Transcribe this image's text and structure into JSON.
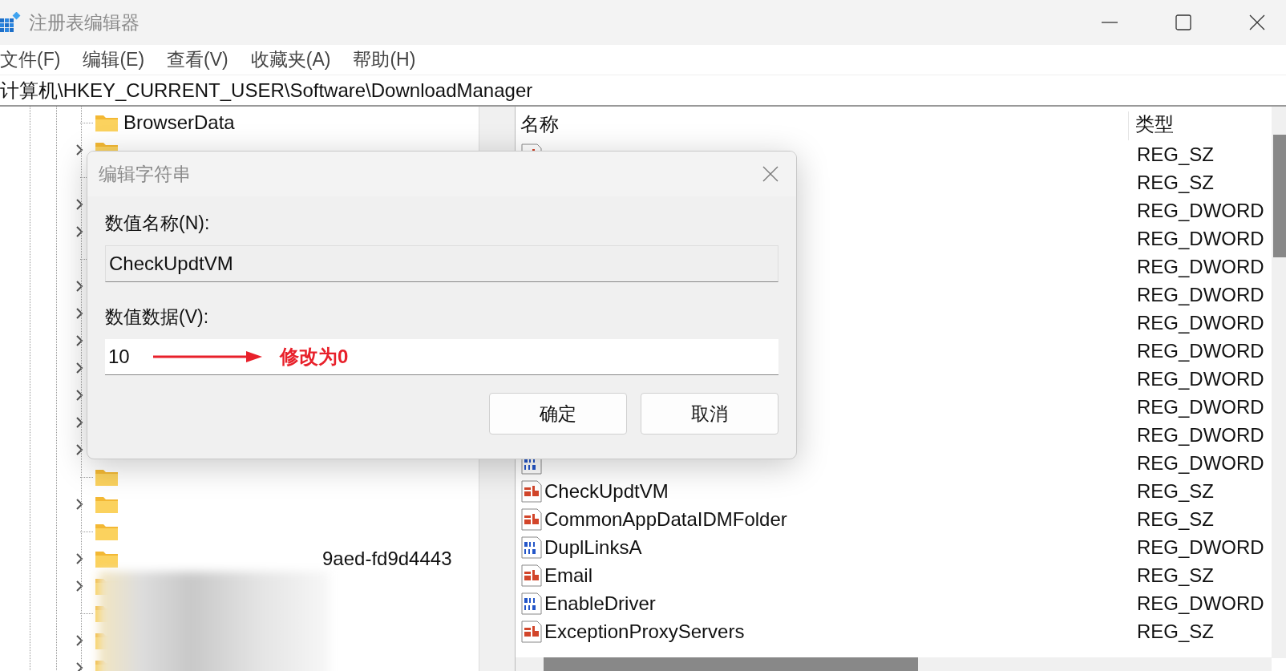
{
  "window": {
    "title": "注册表编辑器"
  },
  "menu": [
    "文件(F)",
    "编辑(E)",
    "查看(V)",
    "收藏夹(A)",
    "帮助(H)"
  ],
  "address": "计算机\\HKEY_CURRENT_USER\\Software\\DownloadManager",
  "tree": [
    {
      "label": "BrowserData",
      "kind": "folder",
      "expandable": false
    },
    {
      "kind": "folder",
      "expandable": true
    },
    {
      "kind": "covered",
      "expandable": false
    },
    {
      "kind": "covered",
      "expandable": true
    },
    {
      "kind": "covered",
      "expandable": true
    },
    {
      "kind": "covered",
      "expandable": false
    },
    {
      "kind": "covered",
      "expandable": true
    },
    {
      "kind": "covered",
      "expandable": true
    },
    {
      "kind": "covered",
      "expandable": true
    },
    {
      "kind": "covered",
      "expandable": true
    },
    {
      "kind": "covered",
      "expandable": true
    },
    {
      "kind": "covered",
      "expandable": true
    },
    {
      "kind": "covered",
      "expandable": true
    },
    {
      "kind": "folder",
      "expandable": false
    },
    {
      "kind": "folder",
      "expandable": true
    },
    {
      "kind": "folder",
      "expandable": false
    },
    {
      "label": "9aed-fd9d4443",
      "kind": "folder",
      "expandable": true,
      "redacted": true
    },
    {
      "kind": "folder",
      "expandable": true
    },
    {
      "kind": "folder",
      "expandable": false
    },
    {
      "kind": "folder",
      "expandable": true
    },
    {
      "kind": "folder",
      "expandable": true
    }
  ],
  "list": {
    "columns": [
      "名称",
      "类型"
    ],
    "rows": [
      {
        "kind": "sz",
        "type": "REG_SZ"
      },
      {
        "type": "REG_SZ"
      },
      {
        "type": "REG_DWORD"
      },
      {
        "type": "REG_DWORD"
      },
      {
        "type": "REG_DWORD"
      },
      {
        "type": "REG_DWORD"
      },
      {
        "type": "REG_DWORD"
      },
      {
        "type": "REG_DWORD"
      },
      {
        "type": "REG_DWORD"
      },
      {
        "type": "REG_DWORD"
      },
      {
        "type": "REG_DWORD"
      },
      {
        "kind": "dword",
        "type": "REG_DWORD"
      },
      {
        "name": "CheckUpdtVM",
        "kind": "sz",
        "type": "REG_SZ"
      },
      {
        "name": "CommonAppDataIDMFolder",
        "kind": "sz",
        "type": "REG_SZ"
      },
      {
        "name": "DuplLinksA",
        "kind": "dword",
        "type": "REG_DWORD"
      },
      {
        "name": "Email",
        "kind": "sz",
        "type": "REG_SZ"
      },
      {
        "name": "EnableDriver",
        "kind": "dword",
        "type": "REG_DWORD"
      },
      {
        "name": "ExceptionProxyServers",
        "kind": "sz",
        "type": "REG_SZ"
      }
    ]
  },
  "dialog": {
    "title": "编辑字符串",
    "name_label": "数值名称(N):",
    "name_value": "CheckUpdtVM",
    "data_label": "数值数据(V):",
    "data_value": "10",
    "annotation": "修改为0",
    "buttons": [
      "确定",
      "取消"
    ]
  }
}
